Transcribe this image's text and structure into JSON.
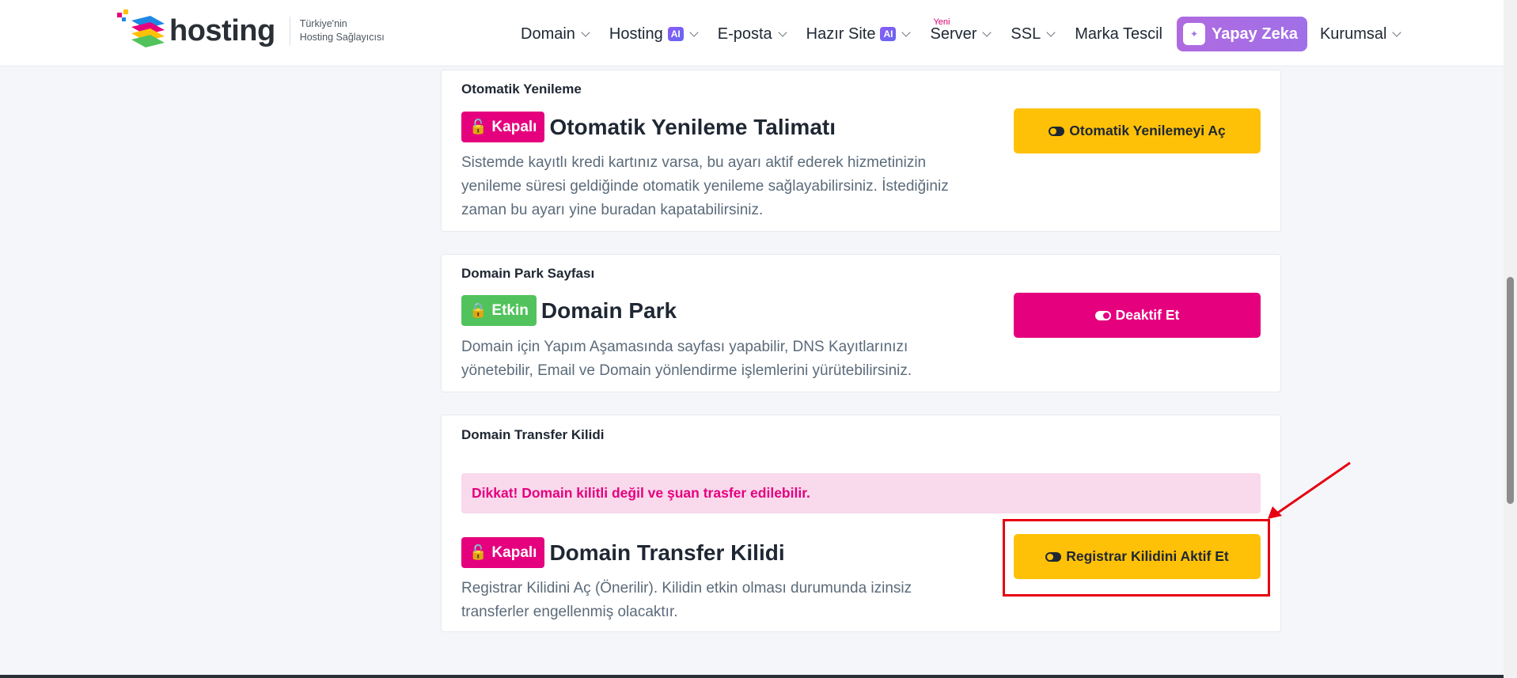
{
  "brand": {
    "name": "hosting",
    "tagline_line1": "Türkiye'nin",
    "tagline_line2": "Hosting Sağlayıcısı"
  },
  "nav": {
    "domain": "Domain",
    "hosting": "Hosting",
    "ai_badge": "AI",
    "eposta": "E-posta",
    "hazir_site": "Hazır Site",
    "server": "Server",
    "new_badge": "Yeni",
    "ssl": "SSL",
    "marka_tescil": "Marka Tescil",
    "yapay_zeka": "Yapay Zeka",
    "kurumsal": "Kurumsal"
  },
  "cards": {
    "auto_renew": {
      "title": "Otomatik Yenileme",
      "status": "Kapalı",
      "heading": "Otomatik Yenileme Talimatı",
      "description": "Sistemde kayıtlı kredi kartınız varsa, bu ayarı aktif ederek hizmetinizin yenileme süresi geldiğinde otomatik yenileme sağlayabilirsiniz. İstediğiniz zaman bu ayarı yine buradan kapatabilirsiniz.",
      "button": "Otomatik Yenilemeyi Aç"
    },
    "domain_park": {
      "title": "Domain Park Sayfası",
      "status": "Etkin",
      "heading": "Domain Park",
      "description": "Domain için Yapım Aşamasında sayfası yapabilir, DNS Kayıtlarınızı yönetebilir, Email ve Domain yönlendirme işlemlerini yürütebilirsiniz.",
      "button": "Deaktif Et"
    },
    "transfer_lock": {
      "title": "Domain Transfer Kilidi",
      "alert": "Dikkat! Domain kilitli değil ve şuan trasfer edilebilir.",
      "status": "Kapalı",
      "heading": "Domain Transfer Kilidi",
      "description": "Registrar Kilidini Aç (Önerilir). Kilidin etkin olması durumunda izinsiz transferler engellenmiş olacaktır.",
      "button": "Registrar Kilidini Aktif Et"
    }
  },
  "colors": {
    "pink": "#e5007e",
    "green": "#52c35c",
    "yellow": "#ffc107",
    "annotation_red": "#e60012"
  }
}
